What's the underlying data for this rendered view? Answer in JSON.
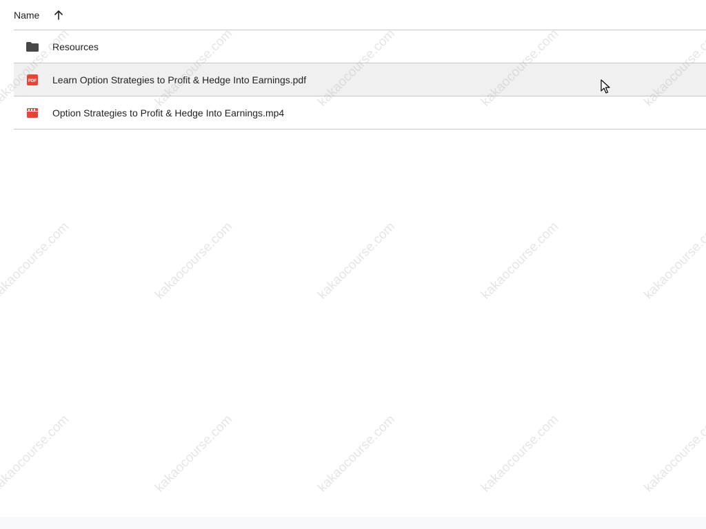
{
  "header": {
    "name_label": "Name",
    "sort_icon": "arrow-up-icon"
  },
  "rows": [
    {
      "label": "Resources",
      "icon": "folder-icon",
      "icon_color": "#444746"
    },
    {
      "label": "Learn Option Strategies to Profit & Hedge Into Earnings.pdf",
      "icon": "pdf-icon",
      "icon_color": "#ea4335",
      "hovered": true
    },
    {
      "label": "Option Strategies to Profit & Hedge Into Earnings.mp4",
      "icon": "video-icon",
      "icon_color": "#ea4335"
    }
  ],
  "watermark": "kakaocourse.com",
  "colors": {
    "hover_bg": "#f0f0f0",
    "divider": "#c7c7c7",
    "pdf_red": "#ea4335"
  }
}
